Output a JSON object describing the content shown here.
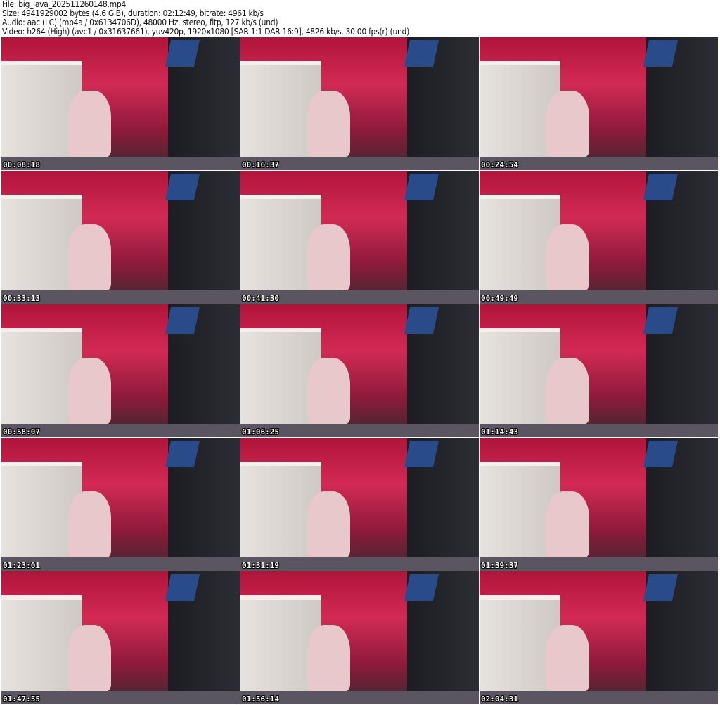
{
  "header": {
    "file": "File: big_lava_202511260148.mp4",
    "size": "Size: 4941929002 bytes (4.6 GiB), duration: 02:12:49, bitrate: 4961 kb/s",
    "audio": "Audio: aac (LC) (mp4a / 0x6134706D), 48000 Hz, stereo, fltp, 127 kb/s (und)",
    "video": "Video: h264 (High) (avc1 / 0x31637661), yuv420p, 1920x1080 [SAR 1:1 DAR 16:9], 4826 kb/s, 30.00 fps(r) (und)"
  },
  "thumbnails": [
    {
      "timestamp": "00:08:18"
    },
    {
      "timestamp": "00:16:37"
    },
    {
      "timestamp": "00:24:54"
    },
    {
      "timestamp": "00:33:13"
    },
    {
      "timestamp": "00:41:30"
    },
    {
      "timestamp": "00:49:49"
    },
    {
      "timestamp": "00:58:07"
    },
    {
      "timestamp": "01:06:25"
    },
    {
      "timestamp": "01:14:43"
    },
    {
      "timestamp": "01:23:01"
    },
    {
      "timestamp": "01:31:19"
    },
    {
      "timestamp": "01:39:37"
    },
    {
      "timestamp": "01:47:55"
    },
    {
      "timestamp": "01:56:14"
    },
    {
      "timestamp": "02:04:31"
    }
  ]
}
